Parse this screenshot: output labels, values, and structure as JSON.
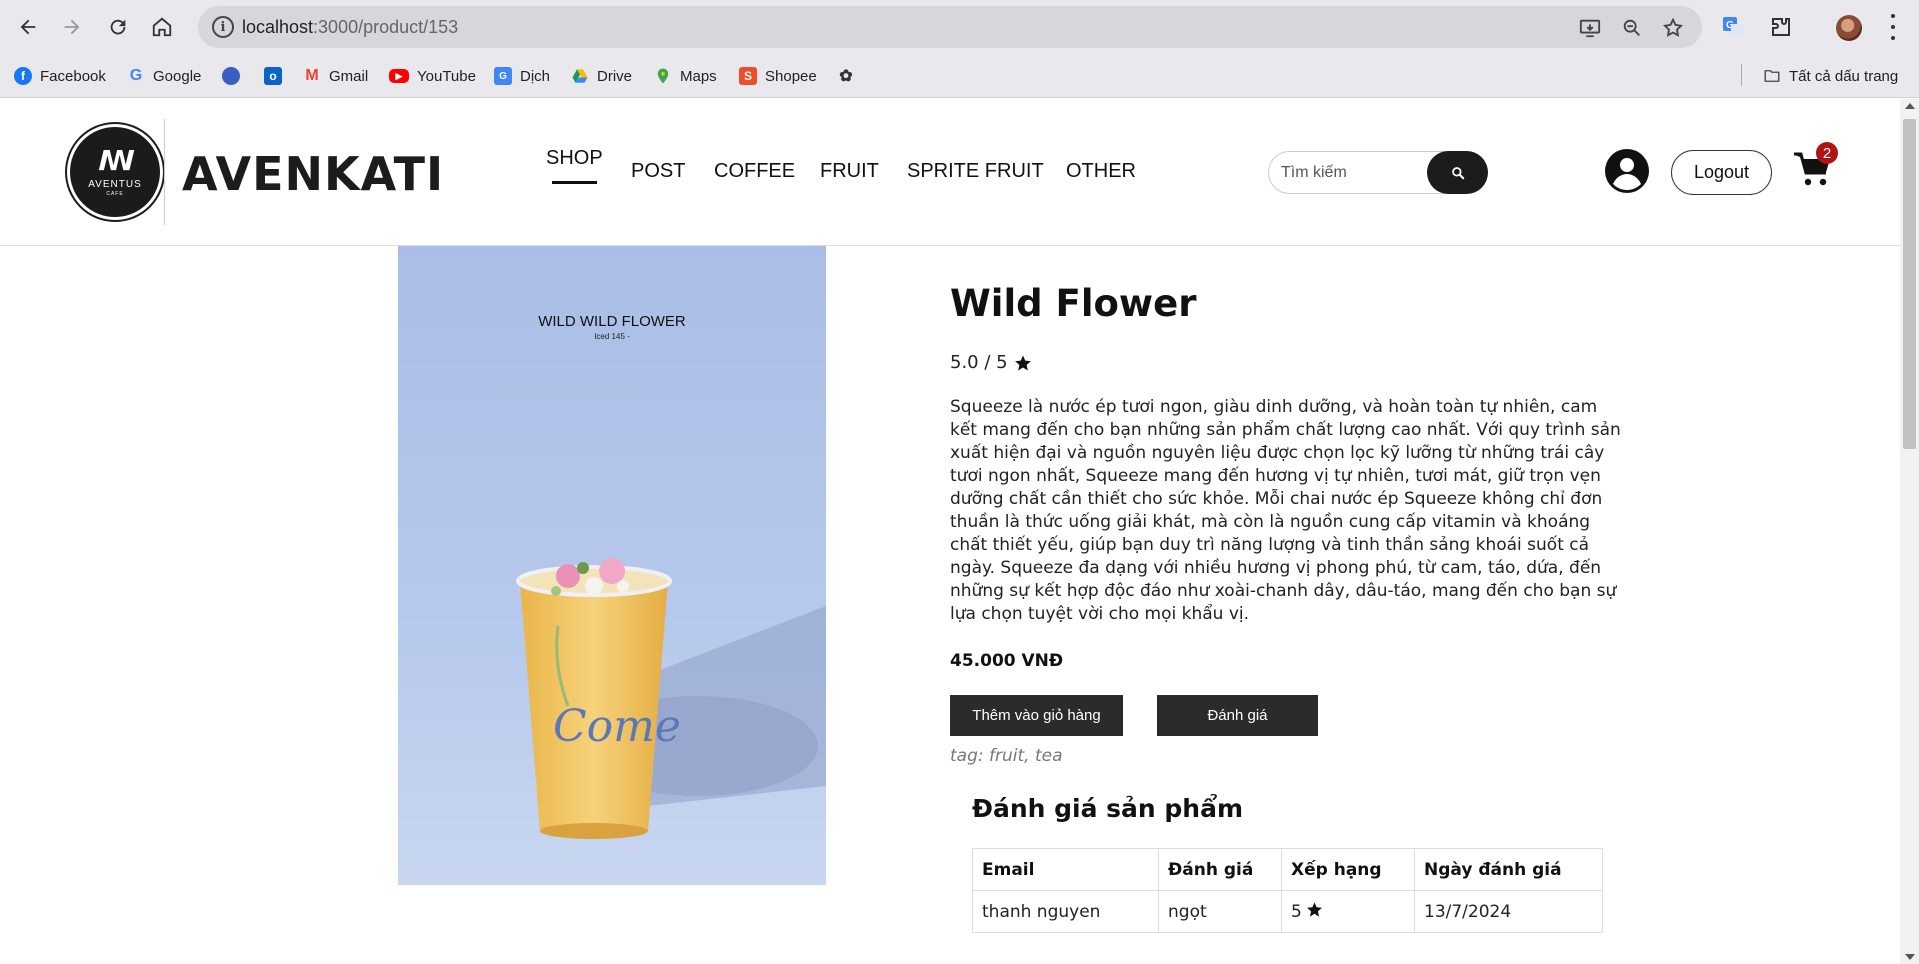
{
  "browser": {
    "url_host": "localhost",
    "url_path": ":3000/product/153",
    "bookmarks": [
      {
        "label": "Facebook",
        "icon": "facebook-icon",
        "color": "#1877f2"
      },
      {
        "label": "Google",
        "icon": "google-icon",
        "color": "#4285f4"
      },
      {
        "label": "",
        "icon": "bookmark-globe-icon",
        "color": "#3b5fc0"
      },
      {
        "label": "",
        "icon": "outlook-icon",
        "color": "#0a64c7"
      },
      {
        "label": "Gmail",
        "icon": "gmail-icon",
        "color": "#ea4335"
      },
      {
        "label": "YouTube",
        "icon": "youtube-icon",
        "color": "#ff0000"
      },
      {
        "label": "Dịch",
        "icon": "translate-icon",
        "color": "#4285f4"
      },
      {
        "label": "Drive",
        "icon": "drive-icon",
        "color": "#0f9d58"
      },
      {
        "label": "Maps",
        "icon": "maps-icon",
        "color": "#34a853"
      },
      {
        "label": "Shopee",
        "icon": "shopee-icon",
        "color": "#ee4d2d"
      },
      {
        "label": "",
        "icon": "chatgpt-icon",
        "color": "#333333"
      }
    ],
    "all_bookmarks": "Tất cả dấu trang"
  },
  "site": {
    "logo_brand": "AVENTUS",
    "logo_sub": "CAFE",
    "name": "AVENKATI",
    "nav": [
      {
        "label": "SHOP",
        "active": true
      },
      {
        "label": "POST"
      },
      {
        "label": "COFFEE"
      },
      {
        "label": "FRUIT"
      },
      {
        "label": "SPRITE FRUIT"
      },
      {
        "label": "OTHER"
      }
    ],
    "search_placeholder": "Tìm kiếm",
    "logout": "Logout",
    "cart_count": "2"
  },
  "product": {
    "image_title": "WILD WILD FLOWER",
    "image_subtitle": "Iced 145 -",
    "image_cup_text": "Come",
    "title": "Wild Flower",
    "rating": "5.0 / 5",
    "description": "Squeeze là nước ép tươi ngon, giàu dinh dưỡng, và hoàn toàn tự nhiên, cam kết mang đến cho bạn những sản phẩm chất lượng cao nhất. Với quy trình sản xuất hiện đại và nguồn nguyên liệu được chọn lọc kỹ lưỡng từ những trái cây tươi ngon nhất, Squeeze mang đến hương vị tự nhiên, tươi mát, giữ trọn vẹn dưỡng chất cần thiết cho sức khỏe. Mỗi chai nước ép Squeeze không chỉ đơn thuần là thức uống giải khát, mà còn là nguồn cung cấp vitamin và khoáng chất thiết yếu, giúp bạn duy trì năng lượng và tinh thần sảng khoái suốt cả ngày. Squeeze đa dạng với nhiều hương vị phong phú, từ cam, táo, dứa, đến những sự kết hợp độc đáo như xoài-chanh dây, dâu-táo, mang đến cho bạn sự lựa chọn tuyệt vời cho mọi khẩu vị.",
    "price": "45.000 VNĐ",
    "add_to_cart": "Thêm vào giỏ hàng",
    "rate_button": "Đánh giá",
    "tags": "tag: fruit, tea"
  },
  "reviews": {
    "title": "Đánh giá sản phẩm",
    "headers": [
      "Email",
      "Đánh giá",
      "Xếp hạng",
      "Ngày đánh giá"
    ],
    "rows": [
      {
        "email": "thanh nguyen",
        "comment": "ngọt",
        "rating": "5",
        "date": "13/7/2024"
      }
    ]
  }
}
